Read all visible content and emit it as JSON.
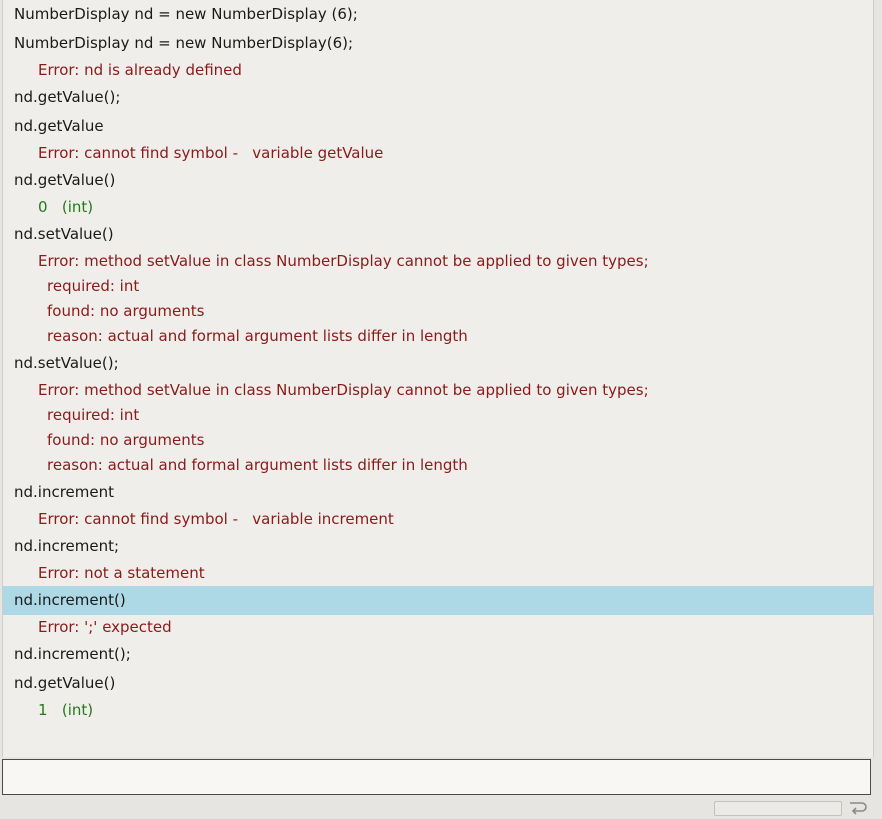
{
  "history": [
    {
      "cmd": "NumberDisplay nd = new NumberDisplay (6);",
      "type": "none",
      "output": []
    },
    {
      "cmd": "NumberDisplay nd = new NumberDisplay(6);",
      "type": "err",
      "output": [
        "Error: nd is already defined"
      ]
    },
    {
      "cmd": "nd.getValue();",
      "type": "none",
      "output": []
    },
    {
      "cmd": "nd.getValue",
      "type": "err",
      "output": [
        "Error: cannot find symbol -   variable getValue"
      ]
    },
    {
      "cmd": "nd.getValue()",
      "type": "val",
      "output": [
        "0   (int)"
      ]
    },
    {
      "cmd": "nd.setValue()",
      "type": "err",
      "output": [
        "Error: method setValue in class NumberDisplay cannot be applied to given types;",
        "required: int",
        "found: no arguments",
        "reason: actual and formal argument lists differ in length"
      ]
    },
    {
      "cmd": "nd.setValue();",
      "type": "err",
      "output": [
        "Error: method setValue in class NumberDisplay cannot be applied to given types;",
        "required: int",
        "found: no arguments",
        "reason: actual and formal argument lists differ in length"
      ]
    },
    {
      "cmd": "nd.increment",
      "type": "err",
      "output": [
        "Error: cannot find symbol -   variable increment"
      ]
    },
    {
      "cmd": "nd.increment;",
      "type": "err",
      "output": [
        "Error: not a statement"
      ]
    },
    {
      "cmd": "nd.increment()",
      "type": "err",
      "selected": true,
      "output": [
        "Error: ';' expected"
      ]
    },
    {
      "cmd": "nd.increment();",
      "type": "none",
      "output": []
    },
    {
      "cmd": "nd.getValue()",
      "type": "val",
      "output": [
        "1   (int)"
      ]
    }
  ],
  "input": {
    "value": ""
  },
  "icons": {
    "wrap": "word-wrap-icon"
  },
  "colors": {
    "error": "#8b1a1a",
    "value": "#237a1a",
    "selection": "#add8e6"
  }
}
